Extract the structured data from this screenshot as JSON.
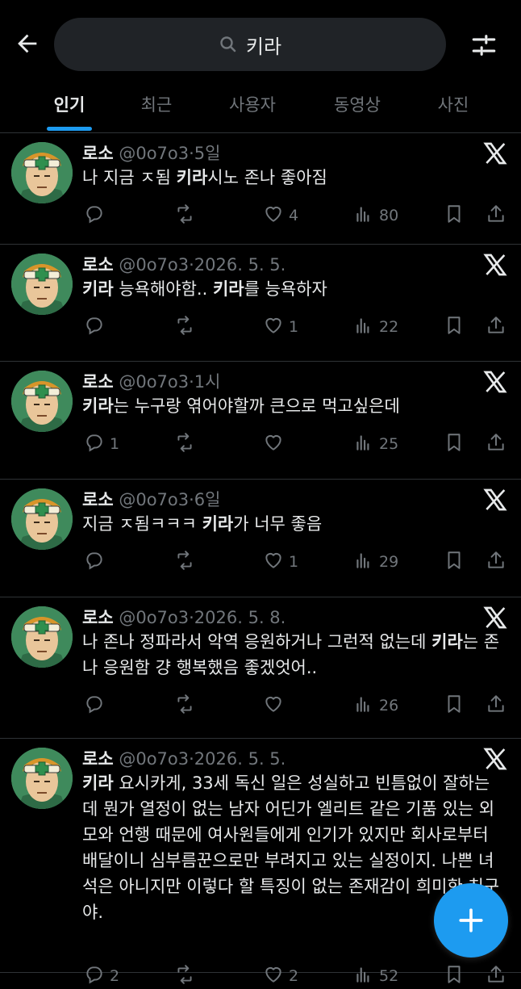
{
  "header": {
    "search_query": "키라"
  },
  "tabs": [
    {
      "label": "인기"
    },
    {
      "label": "최근"
    },
    {
      "label": "사용자"
    },
    {
      "label": "동영상"
    },
    {
      "label": "사진"
    }
  ],
  "posts": [
    {
      "name": "로소",
      "handle": "@0o7o3",
      "time": "5일",
      "text_parts": [
        {
          "t": "나 지금 ㅈ됨 "
        },
        {
          "t": "키라",
          "b": true
        },
        {
          "t": "시노 존나 좋아짐"
        }
      ],
      "replies": "",
      "reposts": "",
      "likes": "4",
      "views": "80"
    },
    {
      "name": "로소",
      "handle": "@0o7o3",
      "time": "2026. 5. 5.",
      "text_parts": [
        {
          "t": "키라",
          "b": true
        },
        {
          "t": " 능욕해야함.. "
        },
        {
          "t": "키라",
          "b": true
        },
        {
          "t": "를 능욕하자"
        }
      ],
      "replies": "",
      "reposts": "",
      "likes": "1",
      "views": "22"
    },
    {
      "name": "로소",
      "handle": "@0o7o3",
      "time": "1시",
      "text_parts": [
        {
          "t": "키라",
          "b": true
        },
        {
          "t": "는 누구랑 엮어야할까 큰으로 먹고싶은데"
        }
      ],
      "replies": "1",
      "reposts": "",
      "likes": "",
      "views": "25"
    },
    {
      "name": "로소",
      "handle": "@0o7o3",
      "time": "6일",
      "text_parts": [
        {
          "t": "지금 ㅈ됨ㅋㅋㅋ "
        },
        {
          "t": "키라",
          "b": true
        },
        {
          "t": "가 너무 좋음"
        }
      ],
      "replies": "",
      "reposts": "",
      "likes": "1",
      "views": "29"
    },
    {
      "name": "로소",
      "handle": "@0o7o3",
      "time": "2026. 5. 8.",
      "text_parts": [
        {
          "t": "나 존나 정파라서 악역 응원하거나 그런적 없는데 "
        },
        {
          "t": "키라",
          "b": true
        },
        {
          "t": "는 존나 응원함 걍 행복했음 좋겠엇어.."
        }
      ],
      "replies": "",
      "reposts": "",
      "likes": "",
      "views": "26"
    },
    {
      "name": "로소",
      "handle": "@0o7o3",
      "time": "2026. 5. 5.",
      "text_parts": [
        {
          "t": "키라",
          "b": true
        },
        {
          "t": " 요시카게, 33세 독신 일은 성실하고 빈틈없이 잘하는데 뭔가 열정이 없는 남자 어딘가 엘리트 같은 기품 있는 외모와 언행 때문에 여사원들에게 인기가 있지만 회사로부터 배달이니 심부름꾼으로만 부려지고 있는 실정이지. 나쁜 녀석은 아니지만 이렇다 할 특징이 없는 존재감이 희미한 친구야."
        }
      ],
      "replies": "2",
      "reposts": "",
      "likes": "2",
      "views": "52"
    }
  ],
  "colors": {
    "accent": "#1d9bf0",
    "muted": "#71767b",
    "text": "#e7e9ea",
    "divider": "#2f3336"
  }
}
